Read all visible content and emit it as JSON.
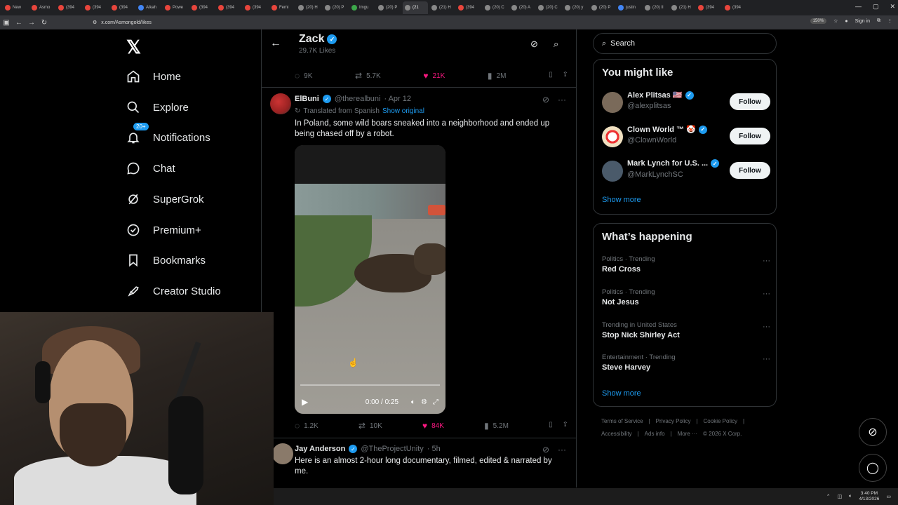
{
  "browser": {
    "tabs": [
      {
        "label": "New",
        "color": "#e8453c"
      },
      {
        "label": "Asmo",
        "color": "#e8453c"
      },
      {
        "label": "(394",
        "color": "#e8453c"
      },
      {
        "label": "(394",
        "color": "#e8453c"
      },
      {
        "label": "(394",
        "color": "#e8453c"
      },
      {
        "label": "Alkah",
        "color": "#4285f4"
      },
      {
        "label": "Powe",
        "color": "#e8453c"
      },
      {
        "label": "(394",
        "color": "#e8453c"
      },
      {
        "label": "(394",
        "color": "#e8453c"
      },
      {
        "label": "(394",
        "color": "#e8453c"
      },
      {
        "label": "Femi",
        "color": "#e8453c"
      },
      {
        "label": "(20) H",
        "color": "#888"
      },
      {
        "label": "(20) P",
        "color": "#888"
      },
      {
        "label": "Imgu",
        "color": "#3ca84a"
      },
      {
        "label": "(20) P",
        "color": "#888"
      },
      {
        "label": "(21",
        "color": "#888"
      },
      {
        "label": "(21) H",
        "color": "#888"
      },
      {
        "label": "(394",
        "color": "#e8453c"
      },
      {
        "label": "(20) C",
        "color": "#888"
      },
      {
        "label": "(20) A",
        "color": "#888"
      },
      {
        "label": "(20) C",
        "color": "#888"
      },
      {
        "label": "(20) y",
        "color": "#888"
      },
      {
        "label": "(20) P",
        "color": "#888"
      },
      {
        "label": "justin",
        "color": "#4285f4"
      },
      {
        "label": "(20) II",
        "color": "#888"
      },
      {
        "label": "(21) H",
        "color": "#888"
      },
      {
        "label": "(394",
        "color": "#e8453c"
      },
      {
        "label": "(394",
        "color": "#e8453c"
      }
    ],
    "active_tab_index": 15,
    "url": "x.com/Asmongold/likes",
    "zoom": "150%",
    "sign_in": "Sign in"
  },
  "nav": {
    "items": [
      {
        "label": "Home",
        "icon": "home-icon"
      },
      {
        "label": "Explore",
        "icon": "search-icon"
      },
      {
        "label": "Notifications",
        "icon": "bell-icon",
        "badge": "20+"
      },
      {
        "label": "Chat",
        "icon": "chat-icon"
      },
      {
        "label": "SuperGrok",
        "icon": "grok-icon"
      },
      {
        "label": "Premium+",
        "icon": "premium-icon"
      },
      {
        "label": "Bookmarks",
        "icon": "bookmark-icon"
      },
      {
        "label": "Creator Studio",
        "icon": "rocket-icon"
      }
    ]
  },
  "header": {
    "name": "Zack",
    "likes": "29.7K Likes"
  },
  "top_post_actions": {
    "replies": "9K",
    "reposts": "5.7K",
    "likes": "21K",
    "views": "2M"
  },
  "post1": {
    "name": "ElBuni",
    "handle": "@therealbuni",
    "date": "· Apr 12",
    "translated": "Translated from Spanish",
    "show_original": "Show original",
    "text": "In Poland, some wild boars sneaked into a neighborhood and ended up being chased off by a robot.",
    "video_time": "0:00 / 0:25",
    "replies": "1.2K",
    "reposts": "10K",
    "likes": "84K",
    "views": "5.2M"
  },
  "post2": {
    "name": "Jay Anderson",
    "handle": "@TheProjectUnity",
    "date": "· 5h",
    "text": "Here is an almost 2-hour long documentary, filmed, edited & narrated by me."
  },
  "search": {
    "placeholder": "Search"
  },
  "you_might_like": {
    "title": "You might like",
    "users": [
      {
        "name": "Alex Plitsas 🇺🇸",
        "handle": "@alexplitsas",
        "avatar_color": "#7a6a5a"
      },
      {
        "name": "Clown World ™ 🤡",
        "handle": "@ClownWorld",
        "avatar_color": "#e8e0d0"
      },
      {
        "name": "Mark Lynch for U.S. ...",
        "handle": "@MarkLynchSC",
        "avatar_color": "#4a5a6a"
      }
    ],
    "follow_label": "Follow",
    "show_more": "Show more"
  },
  "whats_happening": {
    "title": "What’s happening",
    "trends": [
      {
        "category": "Politics · Trending",
        "name": "Red Cross"
      },
      {
        "category": "Politics · Trending",
        "name": "Not Jesus"
      },
      {
        "category": "Trending in United States",
        "name": "Stop Nick Shirley Act"
      },
      {
        "category": "Entertainment · Trending",
        "name": "Steve Harvey"
      }
    ],
    "show_more": "Show more"
  },
  "footer": {
    "links": [
      "Terms of Service",
      "|",
      "Privacy Policy",
      "|",
      "Cookie Policy",
      "|",
      "Accessibility",
      "|",
      "Ads info",
      "|",
      "More ···",
      "© 2026 X Corp."
    ]
  },
  "taskbar": {
    "time": "3:40 PM",
    "date": "4/13/2026"
  }
}
